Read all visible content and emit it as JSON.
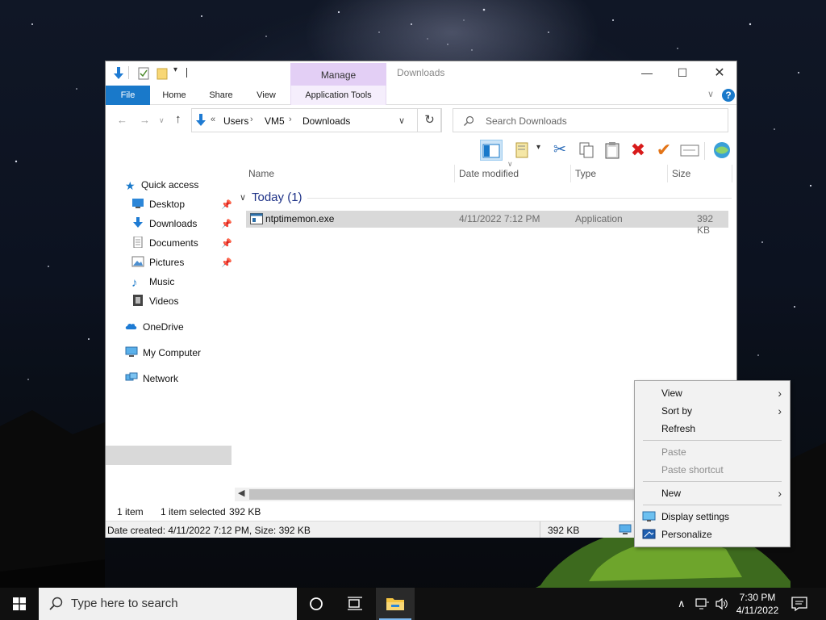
{
  "window": {
    "title": "Downloads",
    "contextual_tab_group": "Manage",
    "ribbon_tabs": [
      "File",
      "Home",
      "Share",
      "View",
      "Application Tools"
    ]
  },
  "address_bar": {
    "overflow": "«",
    "breadcrumbs": [
      "Users",
      "VM5",
      "Downloads"
    ],
    "search_placeholder": "Search Downloads"
  },
  "nav_pane": {
    "quick_access": "Quick access",
    "items": [
      {
        "label": "Desktop",
        "icon": "desktop-icon",
        "pinned": true
      },
      {
        "label": "Downloads",
        "icon": "downloads-icon",
        "pinned": true
      },
      {
        "label": "Documents",
        "icon": "documents-icon",
        "pinned": true
      },
      {
        "label": "Pictures",
        "icon": "pictures-icon",
        "pinned": true
      },
      {
        "label": "Music",
        "icon": "music-icon",
        "pinned": false
      },
      {
        "label": "Videos",
        "icon": "videos-icon",
        "pinned": false
      }
    ],
    "onedrive": "OneDrive",
    "my_computer": "My Computer",
    "network": "Network"
  },
  "file_list": {
    "columns": [
      "Name",
      "Date modified",
      "Type",
      "Size"
    ],
    "group": "Today (1)",
    "rows": [
      {
        "name": "ntptimemon.exe",
        "date": "4/11/2022 7:12 PM",
        "type": "Application",
        "size": "392 KB"
      }
    ]
  },
  "status": {
    "count": "1 item",
    "selected": "1 item selected",
    "selected_size": "392 KB",
    "details": "Date created: 4/11/2022 7:12 PM, Size: 392 KB",
    "details_size": "392 KB"
  },
  "context_menu": {
    "items": [
      {
        "label": "View",
        "submenu": true,
        "disabled": false
      },
      {
        "label": "Sort by",
        "submenu": true,
        "disabled": false
      },
      {
        "label": "Refresh",
        "submenu": false,
        "disabled": false
      },
      {
        "label": "Paste",
        "submenu": false,
        "disabled": true
      },
      {
        "label": "Paste shortcut",
        "submenu": false,
        "disabled": true
      },
      {
        "label": "New",
        "submenu": true,
        "disabled": false
      },
      {
        "label": "Display settings",
        "submenu": false,
        "disabled": false
      },
      {
        "label": "Personalize",
        "submenu": false,
        "disabled": false
      }
    ]
  },
  "taskbar": {
    "search_placeholder": "Type here to search",
    "time": "7:30 PM",
    "date": "4/11/2022"
  },
  "colors": {
    "accent": "#1979ca",
    "contextual_tab": "#e3cff5",
    "selection": "#d9d9d9",
    "taskbar": "#101010"
  }
}
